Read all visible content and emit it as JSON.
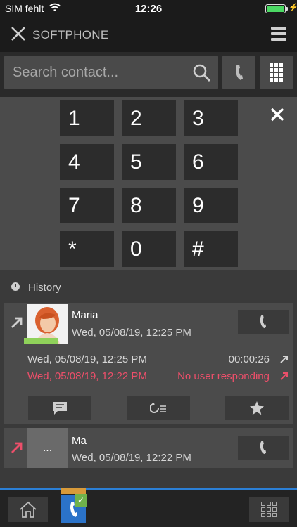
{
  "status_bar": {
    "carrier": "SIM fehlt",
    "time": "12:26",
    "battery_level": 1.0,
    "wifi_icon": "wifi-icon",
    "charging_icon": "charging-bolt-icon"
  },
  "header": {
    "title": "SOFTPHONE",
    "close_icon": "close-icon",
    "menu_icon": "hamburger-menu-icon"
  },
  "search": {
    "placeholder": "Search contact..."
  },
  "dialpad": {
    "keys": [
      "1",
      "2",
      "3",
      "4",
      "5",
      "6",
      "7",
      "8",
      "9",
      "*",
      "0",
      "#"
    ],
    "close_icon": "close-icon"
  },
  "history": {
    "label": "History",
    "entries": [
      {
        "name": "Maria",
        "time": "Wed, 05/08/19, 12:25 PM",
        "direction": "outgoing",
        "arrow_color": "#cfcfcf",
        "details": [
          {
            "time": "Wed, 05/08/19, 12:25 PM",
            "status": "00:00:26",
            "color": "#d5d5d5"
          },
          {
            "time": "Wed, 05/08/19, 12:22 PM",
            "status": "No user responding",
            "color": "#ec4f6a"
          }
        ],
        "actions": [
          "message-icon",
          "call-history-icon",
          "favorite-star-icon"
        ]
      },
      {
        "name": "Ma",
        "time": "Wed, 05/08/19, 12:22 PM",
        "direction": "outgoing-failed",
        "arrow_color": "#ec4f6a",
        "avatar_text": "..."
      }
    ]
  },
  "bottom_bar": {
    "accent": "#2b7fd6",
    "items": [
      "home-icon",
      "softphone-icon",
      "apps-grid-icon"
    ],
    "badge": "✓"
  }
}
